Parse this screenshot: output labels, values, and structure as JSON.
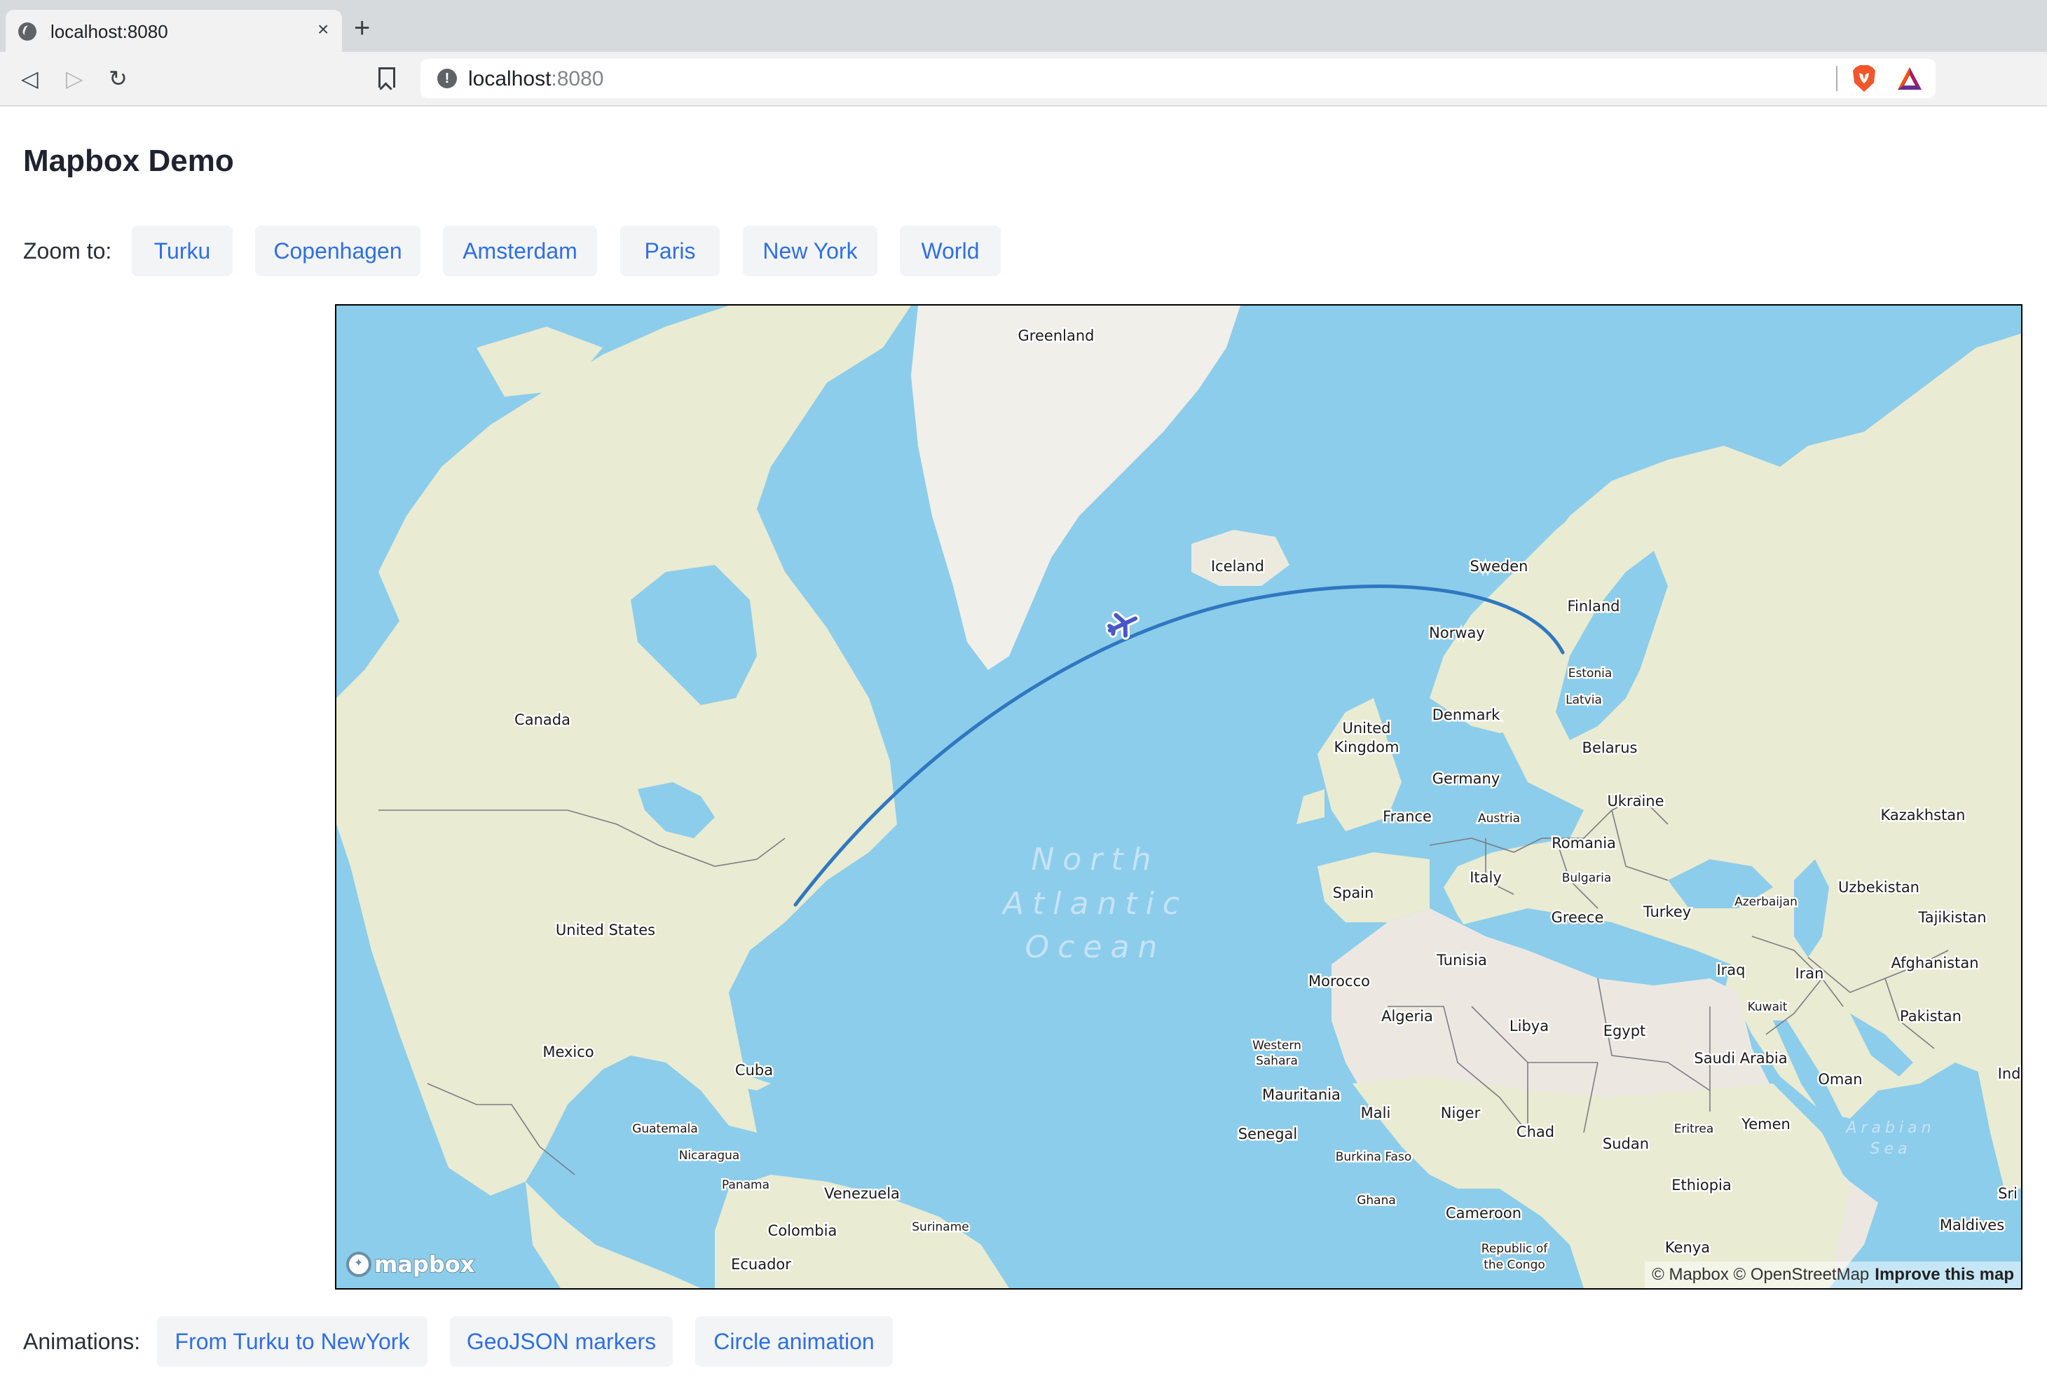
{
  "browser": {
    "tab_title": "localhost:8080",
    "url_host": "localhost",
    "url_port": ":8080",
    "icons": {
      "favicon": "globe-icon",
      "close": "close-icon",
      "new_tab": "plus-icon",
      "back": "back-arrow-icon",
      "forward": "forward-arrow-icon",
      "reload": "reload-icon",
      "bookmark": "bookmark-icon",
      "site_info": "info-icon",
      "brave_shields": "brave-lion-icon",
      "rewards": "bat-triangle-icon"
    },
    "back_glyph": "◁",
    "forward_glyph": "▷",
    "reload_glyph": "↻",
    "close_glyph": "×",
    "newtab_glyph": "+",
    "info_glyph": "!"
  },
  "page": {
    "title": "Mapbox Demo",
    "zoom_label": "Zoom to:",
    "zoom_buttons": [
      "Turku",
      "Copenhagen",
      "Amsterdam",
      "Paris",
      "New York",
      "World"
    ],
    "animations_label": "Animations:",
    "animation_buttons": [
      "From Turku to NewYork",
      "GeoJSON markers",
      "Circle animation"
    ]
  },
  "map": {
    "colors": {
      "water": "#8ccdeb",
      "land": "#e9ebd2",
      "desert": "#ece8e1",
      "ice": "#f1efe9",
      "route": "#2f78c0",
      "plane": "#4a57c8",
      "border": "#7c7c85"
    },
    "route": {
      "from": "New York",
      "to": "Turku"
    },
    "marker": "airplane-icon",
    "oceans": [
      {
        "lines": [
          "North",
          "Atlantic",
          "Ocean"
        ]
      },
      {
        "lines": [
          "Arabian",
          "Sea"
        ]
      }
    ],
    "countries": [
      {
        "name": "Greenland",
        "size": "md"
      },
      {
        "name": "Iceland",
        "size": "md"
      },
      {
        "name": "Sweden",
        "size": "md"
      },
      {
        "name": "Finland",
        "size": "md"
      },
      {
        "name": "Norway",
        "size": "md"
      },
      {
        "name": "Estonia",
        "size": "sm"
      },
      {
        "name": "Latvia",
        "size": "sm"
      },
      {
        "name": "Denmark",
        "size": "md"
      },
      {
        "name": "United",
        "size": "md"
      },
      {
        "name": "Kingdom",
        "size": "md"
      },
      {
        "name": "Belarus",
        "size": "md"
      },
      {
        "name": "Germany",
        "size": "md"
      },
      {
        "name": "Ukraine",
        "size": "md"
      },
      {
        "name": "France",
        "size": "md"
      },
      {
        "name": "Austria",
        "size": "sm"
      },
      {
        "name": "Kazakhstan",
        "size": "md"
      },
      {
        "name": "Romania",
        "size": "md"
      },
      {
        "name": "Spain",
        "size": "md"
      },
      {
        "name": "Italy",
        "size": "md"
      },
      {
        "name": "Bulgaria",
        "size": "sm"
      },
      {
        "name": "Uzbekistan",
        "size": "md"
      },
      {
        "name": "Azerbaijan",
        "size": "sm"
      },
      {
        "name": "Turkey",
        "size": "md"
      },
      {
        "name": "Greece",
        "size": "md"
      },
      {
        "name": "Tajikistan",
        "size": "md"
      },
      {
        "name": "Tunisia",
        "size": "md"
      },
      {
        "name": "Iraq",
        "size": "md"
      },
      {
        "name": "Iran",
        "size": "md"
      },
      {
        "name": "Afghanistan",
        "size": "md"
      },
      {
        "name": "Morocco",
        "size": "md"
      },
      {
        "name": "Kuwait",
        "size": "sm"
      },
      {
        "name": "Algeria",
        "size": "md"
      },
      {
        "name": "Libya",
        "size": "md"
      },
      {
        "name": "Egypt",
        "size": "md"
      },
      {
        "name": "Pakistan",
        "size": "md"
      },
      {
        "name": "Western",
        "size": "sm"
      },
      {
        "name": "Sahara",
        "size": "sm"
      },
      {
        "name": "Saudi Arabia",
        "size": "md"
      },
      {
        "name": "Oman",
        "size": "md"
      },
      {
        "name": "Indi",
        "size": "md"
      },
      {
        "name": "Mauritania",
        "size": "md"
      },
      {
        "name": "Mali",
        "size": "md"
      },
      {
        "name": "Niger",
        "size": "md"
      },
      {
        "name": "Chad",
        "size": "md"
      },
      {
        "name": "Senegal",
        "size": "md"
      },
      {
        "name": "Eritrea",
        "size": "sm"
      },
      {
        "name": "Yemen",
        "size": "md"
      },
      {
        "name": "Sudan",
        "size": "md"
      },
      {
        "name": "Burkina Faso",
        "size": "sm"
      },
      {
        "name": "Ethiopia",
        "size": "md"
      },
      {
        "name": "Ghana",
        "size": "sm"
      },
      {
        "name": "Sri",
        "size": "md"
      },
      {
        "name": "Cameroon",
        "size": "md"
      },
      {
        "name": "Maldives",
        "size": "md"
      },
      {
        "name": "Kenya",
        "size": "md"
      },
      {
        "name": "Republic of",
        "size": "sm"
      },
      {
        "name": "the Congo",
        "size": "sm"
      },
      {
        "name": "Canada",
        "size": "md"
      },
      {
        "name": "United States",
        "size": "md"
      },
      {
        "name": "Mexico",
        "size": "md"
      },
      {
        "name": "Cuba",
        "size": "md"
      },
      {
        "name": "Guatemala",
        "size": "sm"
      },
      {
        "name": "Nicaragua",
        "size": "sm"
      },
      {
        "name": "Panama",
        "size": "sm"
      },
      {
        "name": "Venezuela",
        "size": "md"
      },
      {
        "name": "Colombia",
        "size": "md"
      },
      {
        "name": "Suriname",
        "size": "sm"
      },
      {
        "name": "Ecuador",
        "size": "md"
      }
    ],
    "logo_text": "mapbox",
    "attribution": "© Mapbox © OpenStreetMap",
    "improve_link": "Improve this map"
  }
}
